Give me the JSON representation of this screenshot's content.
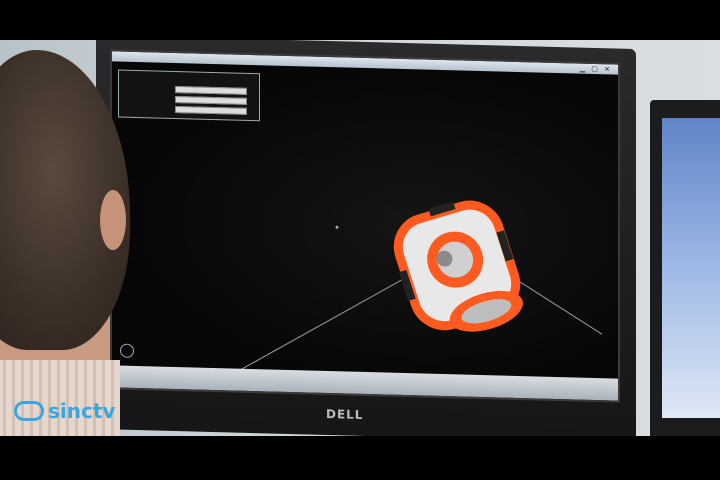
{
  "brand": {
    "logo_text": "sinctv",
    "monitor_brand": "DELL"
  },
  "panel": {
    "title": "",
    "rows": [
      {
        "label": ""
      },
      {
        "label": ""
      },
      {
        "label": ""
      }
    ]
  },
  "colors": {
    "robot_orange": "#ff5a1f",
    "robot_white": "#e8e8e8",
    "logo_blue": "#3aa6e0"
  }
}
